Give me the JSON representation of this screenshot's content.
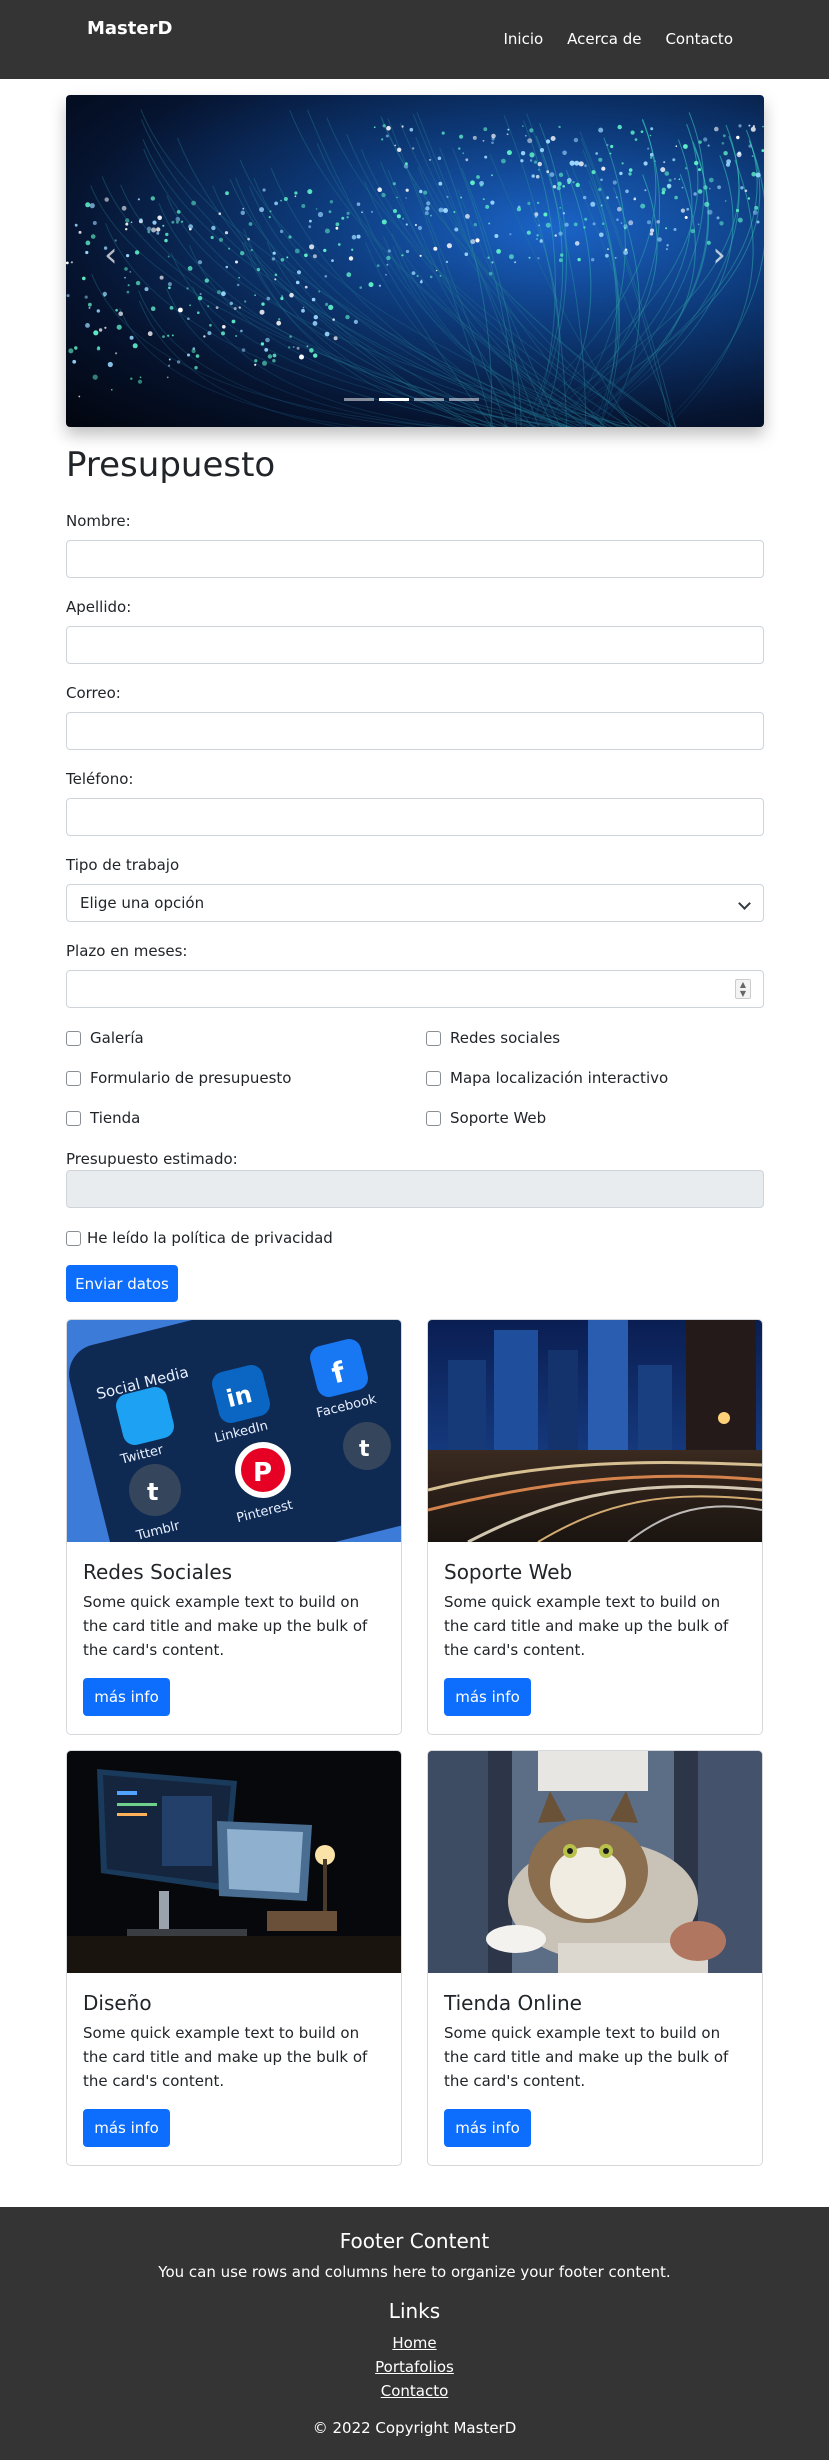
{
  "navbar": {
    "brand": "MasterD",
    "links": [
      "Inicio",
      "Acerca de",
      "Contacto"
    ]
  },
  "carousel": {
    "prev_icon": "chevron-left-icon",
    "next_icon": "chevron-right-icon",
    "prev_glyph": "‹",
    "next_glyph": "›",
    "slides": 4,
    "active_slide": 1
  },
  "form": {
    "title": "Presupuesto",
    "nombre_label": "Nombre:",
    "apellido_label": "Apellido:",
    "correo_label": "Correo:",
    "telefono_label": "Teléfono:",
    "tipo_label": "Tipo de trabajo",
    "tipo_selected": "Elige una opción",
    "plazo_label": "Plazo en meses:",
    "checkboxes": [
      "Galería",
      "Redes sociales",
      "Formulario de presupuesto",
      "Mapa localización interactivo",
      "Tienda",
      "Soporte Web"
    ],
    "estimado_label": "Presupuesto estimado:",
    "privacy_label": "He leído la política de privacidad",
    "submit_label": "Enviar datos"
  },
  "cards": [
    {
      "title": "Redes Sociales",
      "text": "Some quick example text to build on the card title and make up the bulk of the card's content.",
      "button": "más info"
    },
    {
      "title": "Soporte Web",
      "text": "Some quick example text to build on the card title and make up the bulk of the card's content.",
      "button": "más info"
    },
    {
      "title": "Diseño",
      "text": "Some quick example text to build on the card title and make up the bulk of the card's content.",
      "button": "más info"
    },
    {
      "title": "Tienda Online",
      "text": "Some quick example text to build on the card title and make up the bulk of the card's content.",
      "button": "más info"
    }
  ],
  "social_icons": {
    "header": "Social Media",
    "labels": [
      "Twitter",
      "LinkedIn",
      "Facebook",
      "Tumblr",
      "Pinterest"
    ]
  },
  "footer": {
    "title": "Footer Content",
    "text": "You can use rows and columns here to organize your footer content.",
    "links_title": "Links",
    "links": [
      "Home",
      "Portafolios",
      "Contacto"
    ],
    "copyright": "© 2022 Copyright MasterD"
  },
  "colors": {
    "navbar_bg": "#343434",
    "primary": "#0d6efd",
    "footer_bg": "#343434"
  }
}
